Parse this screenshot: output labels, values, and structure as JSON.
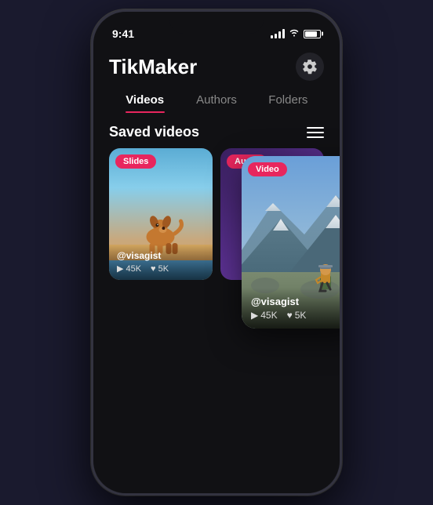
{
  "phone": {
    "status_time": "9:41"
  },
  "app": {
    "title": "TikMaker",
    "tabs": [
      {
        "label": "Videos",
        "active": true
      },
      {
        "label": "Authors",
        "active": false
      },
      {
        "label": "Folders",
        "active": false
      }
    ],
    "section_title": "Saved videos",
    "settings_icon": "gear-icon",
    "menu_icon": "menu-icon"
  },
  "cards": [
    {
      "id": "slides-card",
      "badge": "Slides",
      "author": "@visagist",
      "plays": "45K",
      "likes": "5K",
      "type": "dog"
    },
    {
      "id": "audio-card",
      "badge": "Audio",
      "type": "audio"
    }
  ],
  "floating_card": {
    "badge": "Video",
    "author": "@visagist",
    "plays": "45K",
    "likes": "5K"
  },
  "colors": {
    "accent": "#e8265e",
    "dark_bg": "#111114",
    "card_dark": "#222228"
  }
}
